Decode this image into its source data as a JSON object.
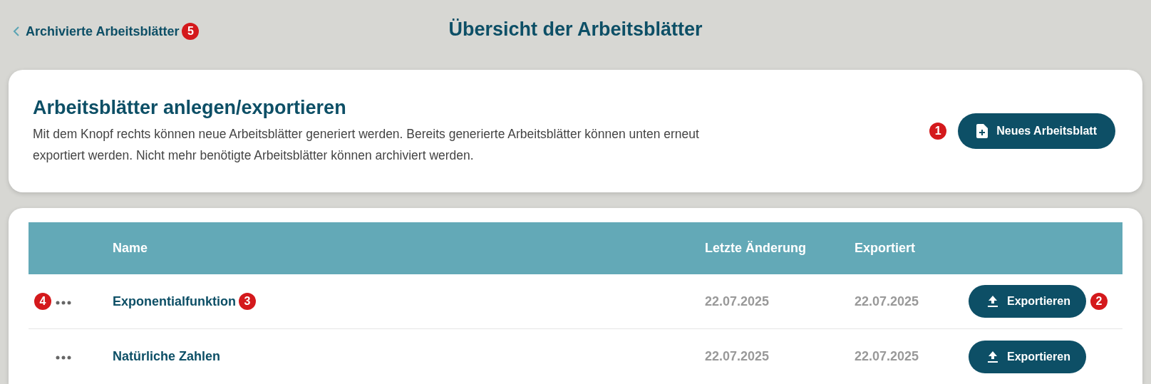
{
  "header": {
    "back_link": {
      "label": "Archivierte Arbeitsblätter",
      "marker": "5"
    },
    "title": "Übersicht der Arbeitsblätter"
  },
  "intro_card": {
    "title": "Arbeitsblätter anlegen/exportieren",
    "text": "Mit dem Knopf rechts können neue Arbeitsblätter generiert werden. Bereits generierte Arbeitsblätter können unten erneut exportiert werden. Nicht mehr benötigte Arbeitsblätter können archiviert werden.",
    "button": {
      "label": "Neues Arbeitsblatt",
      "marker": "1"
    }
  },
  "table": {
    "columns": [
      "Name",
      "Letzte Änderung",
      "Exportiert"
    ],
    "rows": [
      {
        "menu_marker": "4",
        "name": "Exponentialfunktion",
        "name_marker": "3",
        "changed": "22.07.2025",
        "exported": "22.07.2025",
        "button": "Exportieren",
        "button_marker": "2"
      },
      {
        "name": "Natürliche Zahlen",
        "changed": "22.07.2025",
        "exported": "22.07.2025",
        "button": "Exportieren"
      }
    ]
  }
}
